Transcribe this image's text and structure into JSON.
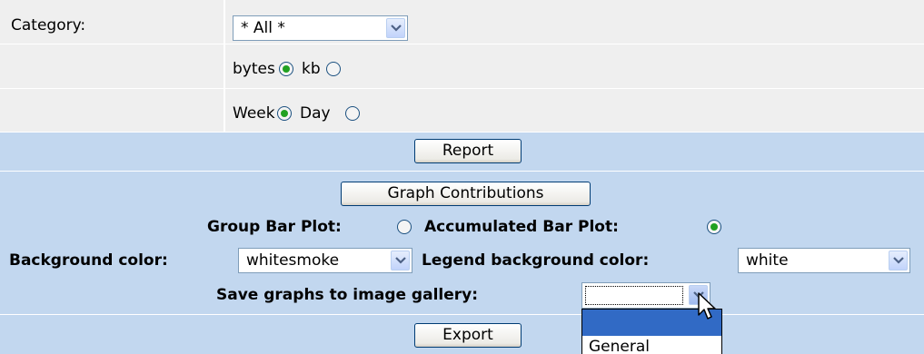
{
  "filters": {
    "category_label": "Category:",
    "category_value": "* All *",
    "bytes_label": "bytes",
    "kb_label": "kb",
    "week_label": "Week",
    "day_label": "Day"
  },
  "report": {
    "button_label": "Report"
  },
  "graph": {
    "button_label": "Graph Contributions",
    "group_bar_label": "Group Bar Plot:",
    "accumulated_bar_label": "Accumulated Bar Plot:",
    "background_label": "Background color:",
    "background_value": "whitesmoke",
    "legend_background_label": "Legend background color:",
    "legend_background_value": "white",
    "gallery_label": "Save graphs to image gallery:",
    "gallery_value": ""
  },
  "export": {
    "button_label": "Export"
  },
  "gallery_dropdown": {
    "options": [
      "",
      "General"
    ]
  },
  "colors": {
    "row_grey": "#efefef",
    "row_blue": "#c2d7ef",
    "radio_selected": "#21a121",
    "highlight": "#316ac5"
  },
  "icons": {
    "select_arrow": "chevron-down-icon",
    "cursor": "mouse-pointer-icon"
  }
}
